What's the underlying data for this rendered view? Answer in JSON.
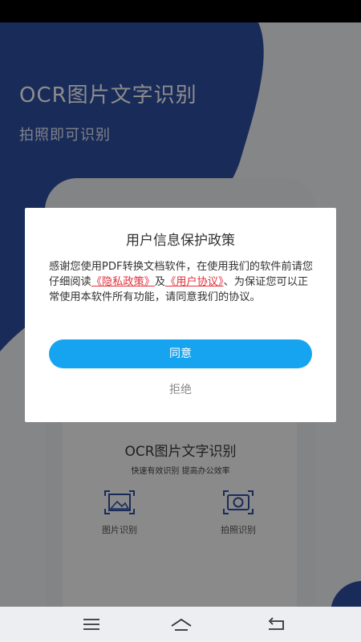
{
  "app": {
    "hero_title": "OCR图片文字识别",
    "hero_subtitle": "拍照即可识别",
    "card_title": "OCR图片文字识别",
    "card_subtitle": "快速有效识别  提高办公效率",
    "features": [
      {
        "label": "图片识别",
        "icon": "image-scan-icon"
      },
      {
        "label": "拍照识别",
        "icon": "camera-scan-icon"
      }
    ]
  },
  "dialog": {
    "title": "用户信息保护政策",
    "body_part1": "感谢您使用PDF转换文档软件，在使用我们的软件前请您仔细阅读",
    "privacy_link": "《隐私政策》",
    "body_part2": "及",
    "agreement_link": "《用户协议》",
    "body_part3": "、为保证您可以正常使用本软件所有功能，请同意我们的协议。",
    "agree_label": "同意",
    "reject_label": "拒绝"
  },
  "nav": {
    "menu_icon": "menu-icon",
    "home_icon": "home-icon",
    "back_icon": "back-icon"
  },
  "colors": {
    "hero_blue": "#2f4fa3",
    "agree_button": "#16a4f0",
    "link_red": "#e0313c"
  }
}
